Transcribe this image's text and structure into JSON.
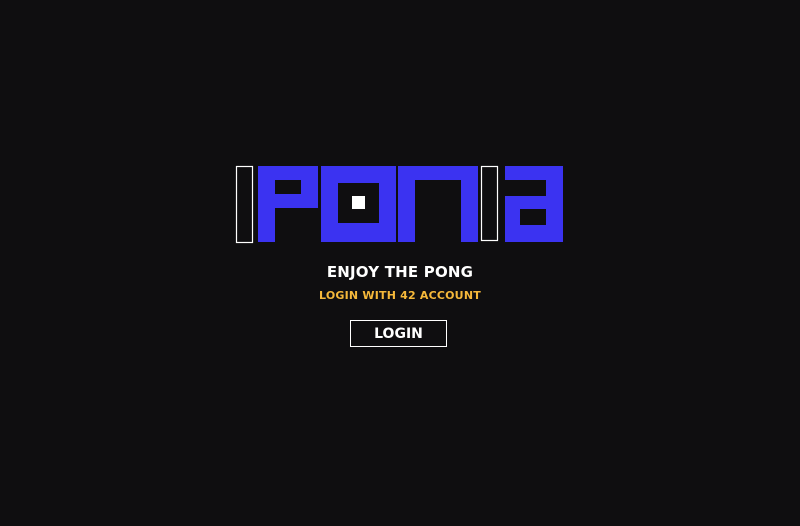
{
  "logo": {
    "label": "PONG",
    "accent_color": "#3b33f1",
    "outline_color": "#ffffff"
  },
  "tagline": "ENJOY THE PONG",
  "subtag": "LOGIN WITH 42 ACCOUNT",
  "login_label": "LOGIN",
  "colors": {
    "background": "#0f0e10",
    "subtag": "#f5b83a"
  }
}
